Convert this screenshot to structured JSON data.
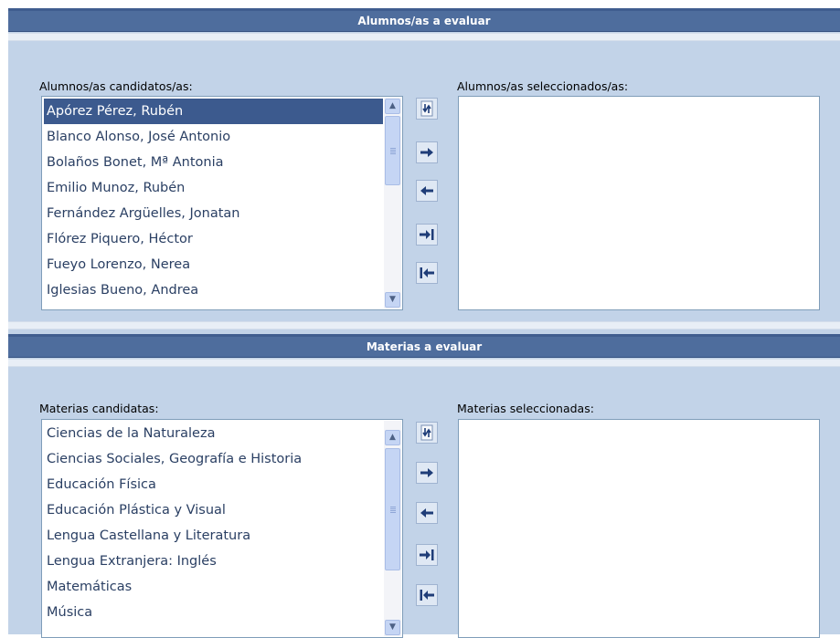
{
  "alumnos": {
    "title": "Alumnos/as a evaluar",
    "candidates_label": "Alumnos/as candidatos/as:",
    "selected_label": "Alumnos/as seleccionados/as:",
    "candidates": [
      "Apórez Pérez, Rubén",
      "Blanco Alonso, José Antonio",
      "Bolaños Bonet, Mª Antonia",
      "Emilio Munoz, Rubén",
      "Fernández Argüelles, Jonatan",
      "Flórez Piquero, Héctor",
      "Fueyo Lorenzo, Nerea",
      "Iglesias Bueno, Andrea"
    ],
    "selected_index": 0,
    "selected": []
  },
  "materias": {
    "title": "Materias a evaluar",
    "candidates_label": "Materias candidatas:",
    "selected_label": "Materias seleccionadas:",
    "candidates": [
      "Ciencias de la Naturaleza",
      "Ciencias Sociales, Geografía e Historia",
      "Educación Física",
      "Educación Plástica y Visual",
      "Lengua Castellana y Literatura",
      "Lengua Extranjera: Inglés",
      "Matemáticas",
      "Música"
    ],
    "selected": []
  },
  "controls": [
    "swap-icon",
    "move-right-icon",
    "move-left-icon",
    "move-all-right-icon",
    "move-all-left-icon"
  ],
  "colors": {
    "header_bg": "#4e6d9d",
    "panel_bg": "#c2d3e8",
    "selected_row_bg": "#3c5a8e",
    "arrow_color": "#1f3d78",
    "list_text": "#2a3f63"
  }
}
